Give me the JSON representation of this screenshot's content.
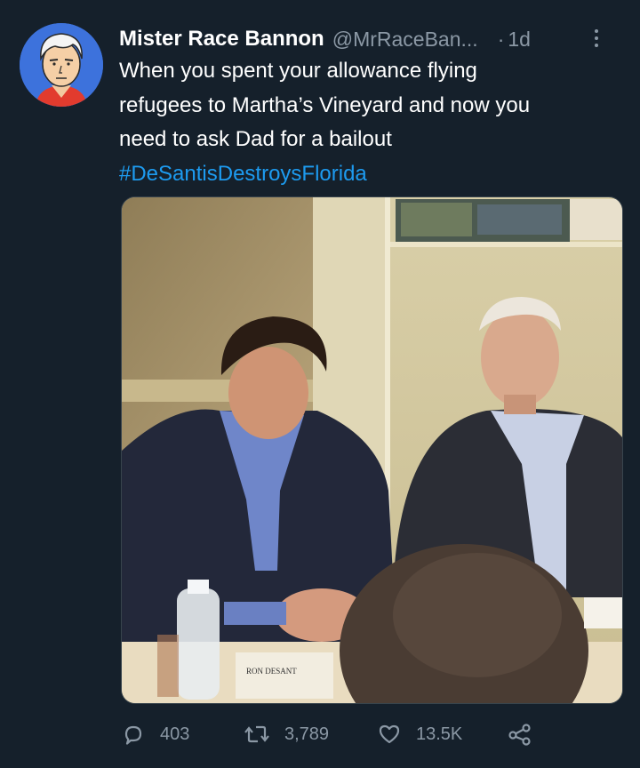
{
  "tweet": {
    "author_name": "Mister Race Bannon",
    "handle": "@MrRaceBan...",
    "separator": "·",
    "time": "1d",
    "text_lines": [
      "When you spent your allowance flying",
      "refugees to Martha’s Vineyard and now you",
      "need to ask Dad for a bailout"
    ],
    "hashtag": "#DeSantisDestroysFlorida",
    "media": {
      "placard_text": "RON DESANT"
    }
  },
  "actions": {
    "reply": {
      "icon": "reply-icon",
      "count": "403"
    },
    "retweet": {
      "icon": "retweet-icon",
      "count": "3,789"
    },
    "like": {
      "icon": "heart-icon",
      "count": "13.5K"
    },
    "share": {
      "icon": "share-icon"
    }
  },
  "colors": {
    "background": "#15202b",
    "secondary_text": "#8b98a5",
    "link": "#1d9bf0"
  }
}
